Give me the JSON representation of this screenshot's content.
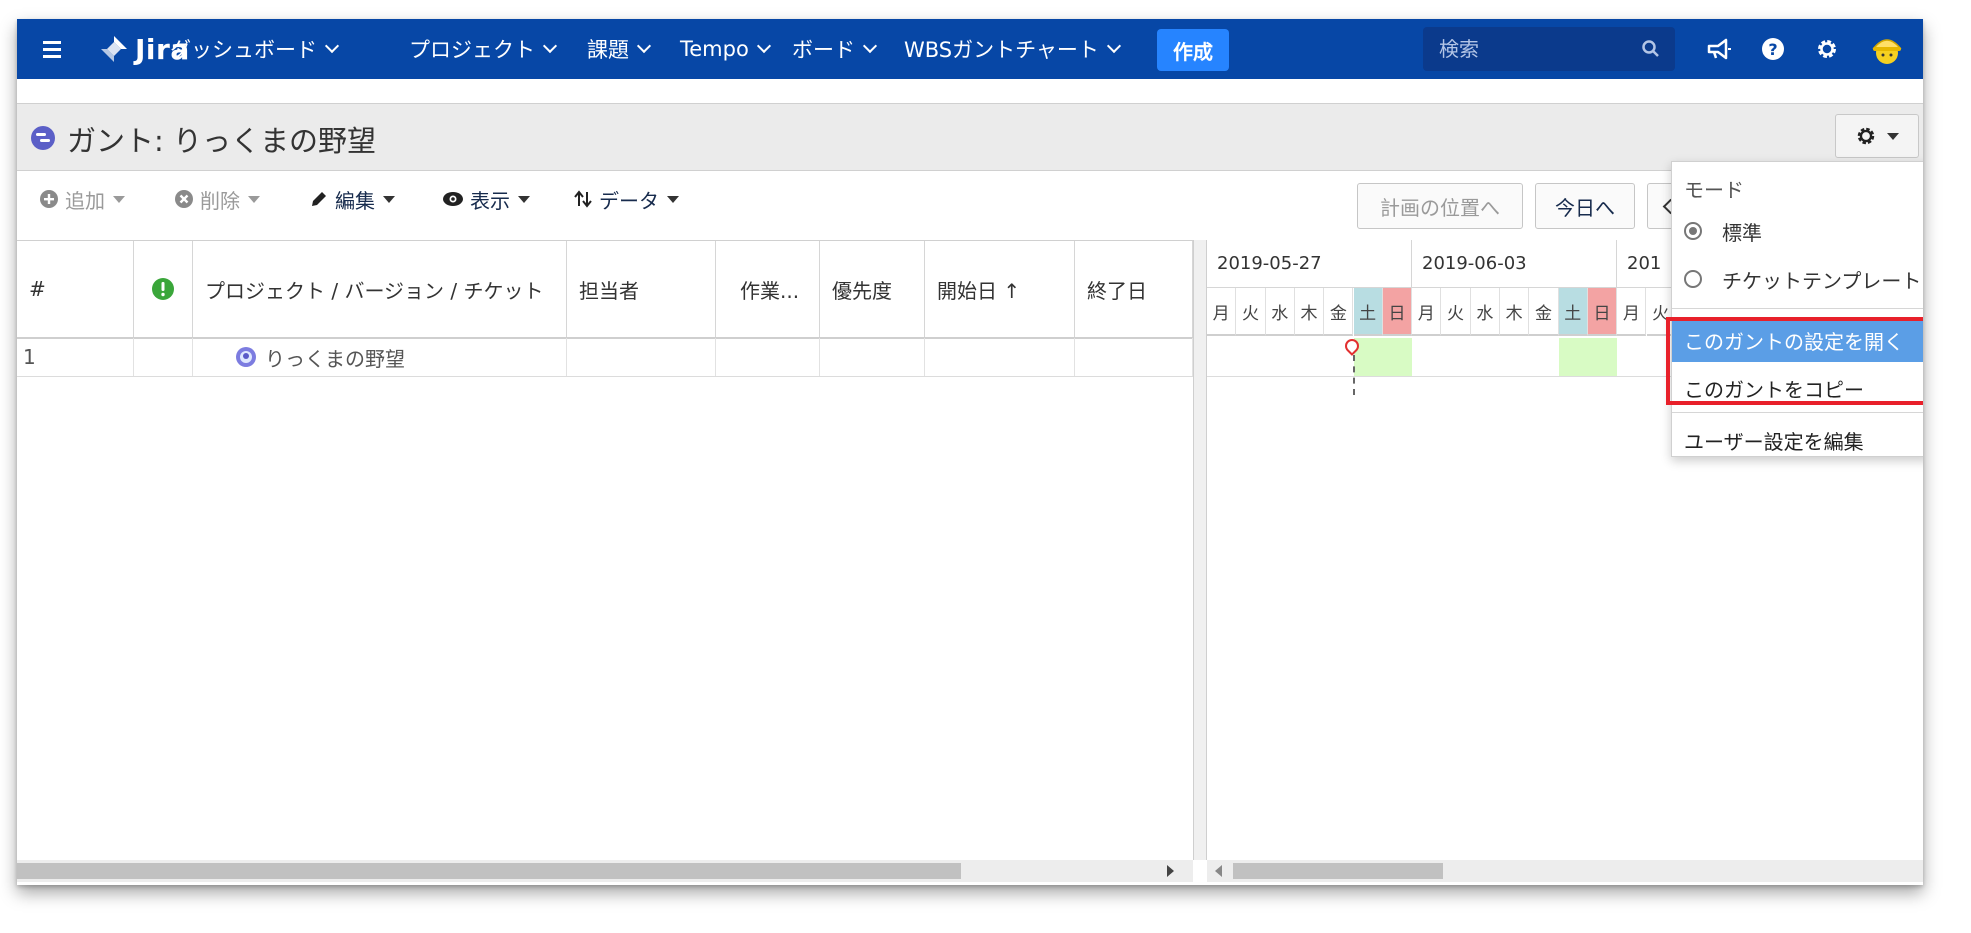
{
  "nav": {
    "logo_text": "Jira",
    "links": [
      "ダッシュボード",
      "プロジェクト",
      "課題",
      "Tempo",
      "ボード",
      "WBSガントチャート"
    ],
    "create_label": "作成",
    "search_placeholder": "検索"
  },
  "page": {
    "title": "ガント: りっくまの野望"
  },
  "toolbar": {
    "add_label": "追加",
    "delete_label": "削除",
    "edit_label": "編集",
    "view_label": "表示",
    "data_label": "データ",
    "plan_position_label": "計画の位置へ",
    "today_label": "今日へ"
  },
  "table": {
    "columns": [
      "#",
      "",
      "プロジェクト / バージョン / チケット",
      "担当者",
      "作業...",
      "優先度",
      "開始日 ↑",
      "終了日"
    ],
    "rows": [
      {
        "num": "1",
        "name": "りっくまの野望"
      }
    ]
  },
  "timeline": {
    "weeks": [
      "2019-05-27",
      "2019-06-03",
      "201"
    ],
    "days": [
      "月",
      "火",
      "水",
      "木",
      "金",
      "土",
      "日",
      "月",
      "火",
      "水",
      "木",
      "金",
      "土",
      "日",
      "月",
      "火"
    ]
  },
  "dropdown": {
    "mode_label": "モード",
    "mode_options": [
      "標準",
      "チケットテンプレート"
    ],
    "selected_mode": "標準",
    "items": [
      "このガントの設定を開く",
      "このガントをコピー",
      "ユーザー設定を編集"
    ]
  },
  "colors": {
    "nav_bg": "#0747a6",
    "create_bg": "#2684ff",
    "highlight": "#e8202a",
    "active_item": "#5b9ee6",
    "saturday": "#b8dde2",
    "sunday": "#f3a3a3",
    "weekend_cell": "#d8fbc4"
  }
}
